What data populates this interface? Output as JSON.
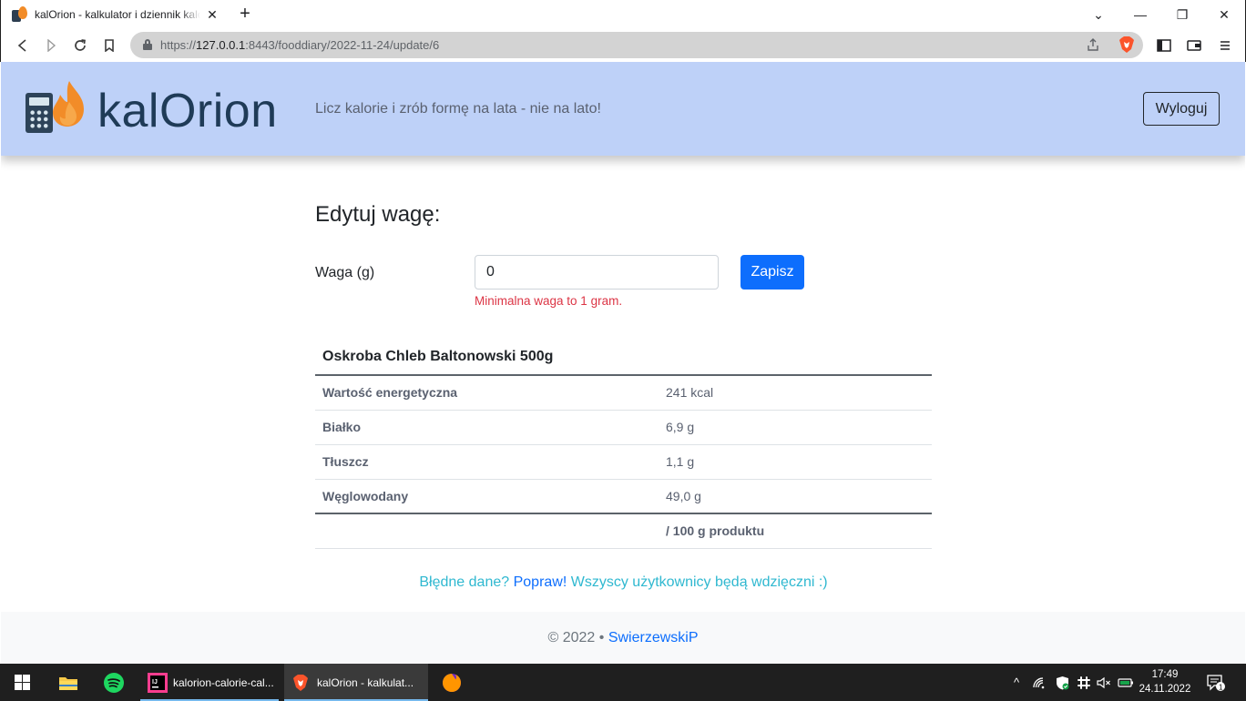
{
  "browser": {
    "tab_title": "kalOrion - kalkulator i dziennik kalorii",
    "url_scheme": "https://",
    "url_host": "127.0.0.1",
    "url_rest": ":8443/fooddiary/2022-11-24/update/6"
  },
  "header": {
    "brand": "kalOrion",
    "tagline": "Licz kalorie i zrób formę na lata - nie na lato!",
    "logout_label": "Wyloguj"
  },
  "form": {
    "title": "Edytuj wagę:",
    "weight_label": "Waga (g)",
    "weight_value": "0",
    "save_label": "Zapisz",
    "error": "Minimalna waga to 1 gram."
  },
  "product": {
    "name": "Oskroba Chleb Baltonowski 500g",
    "rows": [
      {
        "label": "Wartość energetyczna",
        "value": "241 kcal"
      },
      {
        "label": "Białko",
        "value": "6,9 g"
      },
      {
        "label": "Tłuszcz",
        "value": "1,1 g"
      },
      {
        "label": "Węglowodany",
        "value": "49,0 g"
      }
    ],
    "per_unit": "/ 100 g produktu"
  },
  "fix_prompt": {
    "before": "Błędne dane?",
    "link": "Popraw!",
    "after": "Wszyscy użytkownicy będą wdzięczni :)"
  },
  "footer": {
    "copyright": "© 2022 •",
    "author": "SwierzewskiP"
  },
  "taskbar": {
    "app1_label": "kalorion-calorie-cal...",
    "app2_label": "kalOrion - kalkulat...",
    "time": "17:49",
    "date": "24.11.2022",
    "notifications": "1"
  },
  "colors": {
    "header_bg": "#bed1f8",
    "primary": "#0d6efd",
    "error": "#dc3545",
    "info": "#2fb8d0"
  }
}
